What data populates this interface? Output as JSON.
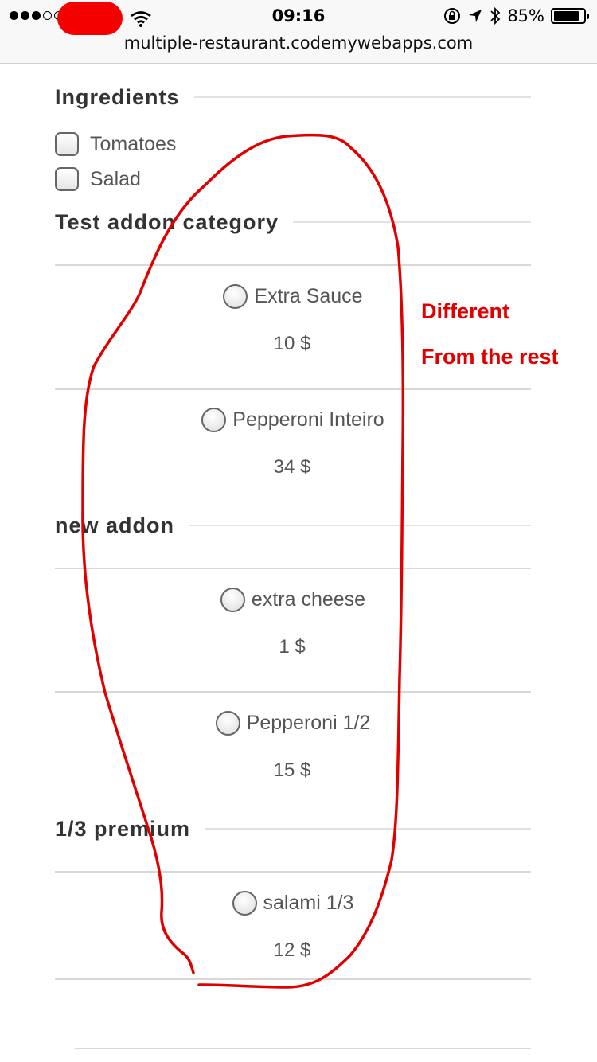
{
  "status_bar": {
    "time": "09:16",
    "battery_percent": "85%",
    "battery_level": 0.85,
    "url": "multiple-restaurant.codemywebapps.com"
  },
  "ingredients": {
    "heading": "Ingredients",
    "items": [
      {
        "label": "Tomatoes",
        "checked": false
      },
      {
        "label": "Salad",
        "checked": false
      }
    ]
  },
  "addon_groups": [
    {
      "heading": "Test addon category",
      "options": [
        {
          "label": "Extra Sauce",
          "price": "10 $"
        },
        {
          "label": "Pepperoni Inteiro",
          "price": "34 $"
        }
      ]
    },
    {
      "heading": "new addon",
      "options": [
        {
          "label": "extra cheese",
          "price": "1 $"
        },
        {
          "label": "Pepperoni 1/2",
          "price": "15 $"
        }
      ]
    },
    {
      "heading": "1/3 premium",
      "options": [
        {
          "label": "salami 1/3",
          "price": "12 $"
        }
      ]
    }
  ],
  "annotation": {
    "line1": "Different",
    "line2": "From the rest",
    "color": "#e00000"
  }
}
